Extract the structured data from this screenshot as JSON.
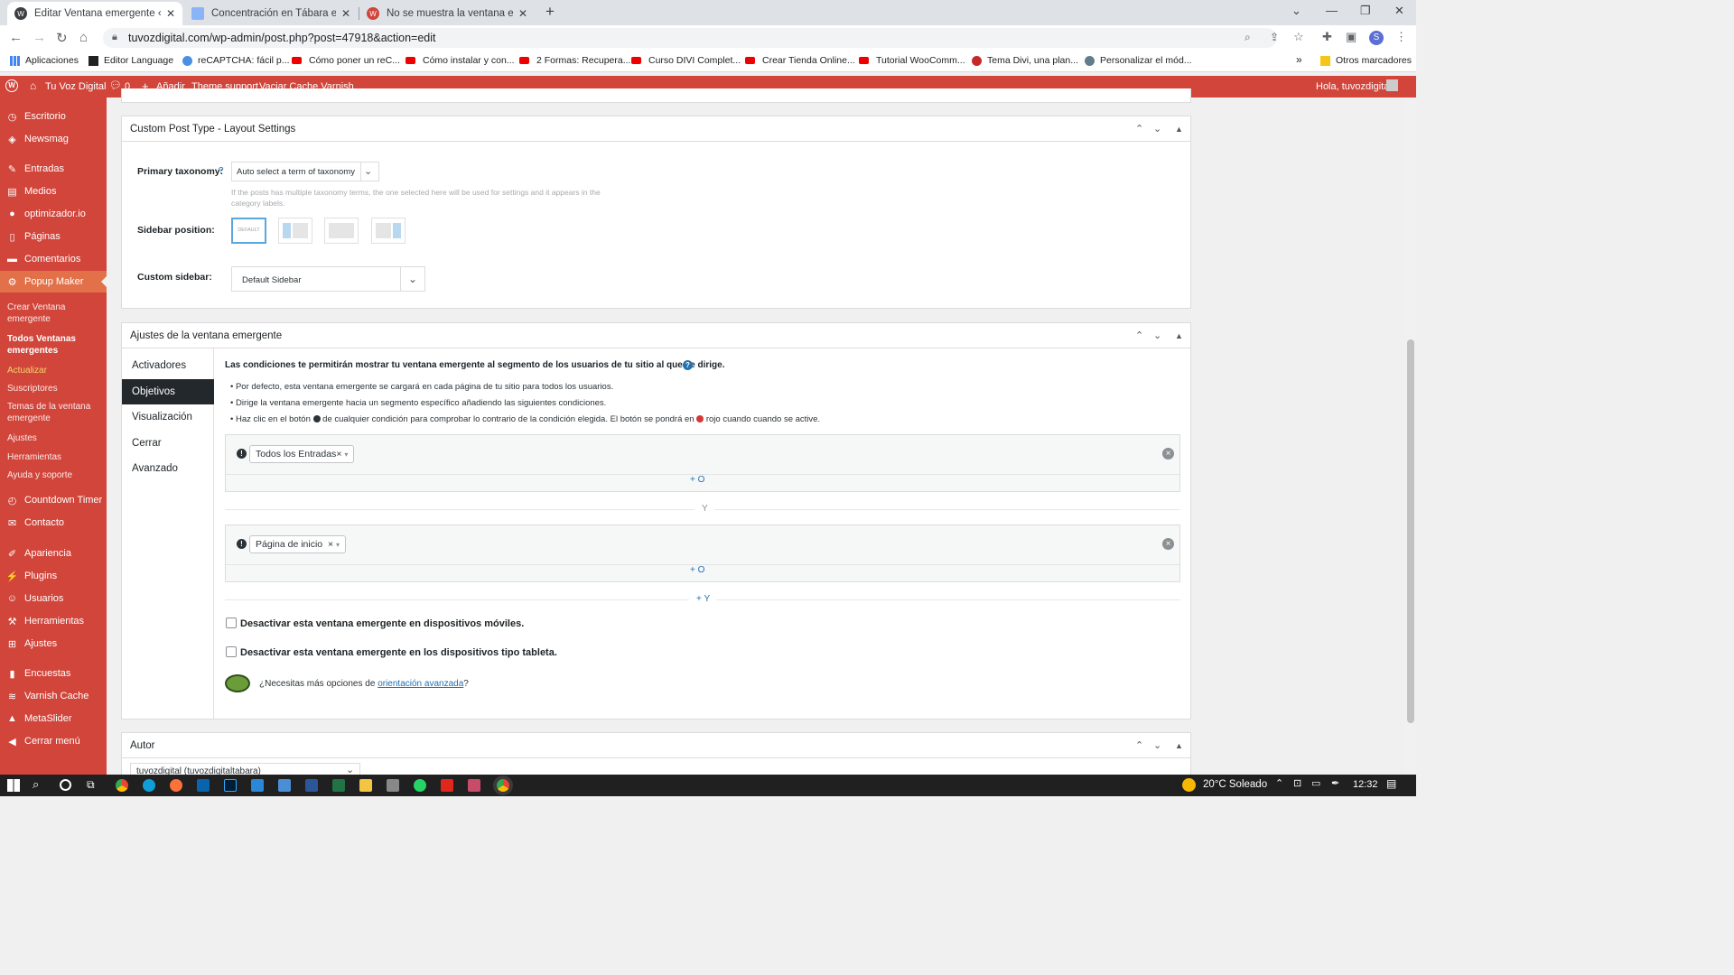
{
  "browser": {
    "tabs": [
      {
        "title": "Editar Ventana emergente «Prue",
        "active": true
      },
      {
        "title": "Concentración en Tábara en defe",
        "active": false
      },
      {
        "title": "No se muestra la ventana emerg",
        "active": false
      }
    ],
    "new_tab_label": "+",
    "url": "tuvozdigital.com/wp-admin/post.php?post=47918&action=edit",
    "profile_initial": "S",
    "bookmarks": [
      "Aplicaciones",
      "Editor Language",
      "reCAPTCHA: fácil p...",
      "Cómo poner un reC...",
      "Cómo instalar y con...",
      "2 Formas: Recupera...",
      "Curso DIVI Complet...",
      "Crear Tienda Online...",
      "Tutorial WooComm...",
      "Tema Divi, una plan...",
      "Personalizar el mód..."
    ],
    "bookmarks_more": "»",
    "other_bookmarks": "Otros marcadores"
  },
  "adminbar": {
    "site_name": "Tu Voz Digital",
    "comments_count": "0",
    "add_new": "Añadir",
    "theme_support": "Theme support",
    "vaciar_cache": "Vaciar Cache Varnish",
    "greeting": "Hola, tuvozdigital"
  },
  "sidebar": {
    "items": [
      {
        "label": "Escritorio"
      },
      {
        "label": "Newsmag"
      },
      {
        "label": "Entradas"
      },
      {
        "label": "Medios"
      },
      {
        "label": "optimizador.io"
      },
      {
        "label": "Páginas"
      },
      {
        "label": "Comentarios"
      },
      {
        "label": "Popup Maker"
      },
      {
        "label": "Countdown Timer"
      },
      {
        "label": "Contacto"
      },
      {
        "label": "Apariencia"
      },
      {
        "label": "Plugins"
      },
      {
        "label": "Usuarios"
      },
      {
        "label": "Herramientas"
      },
      {
        "label": "Ajustes"
      },
      {
        "label": "Encuestas"
      },
      {
        "label": "Varnish Cache"
      },
      {
        "label": "MetaSlider"
      },
      {
        "label": "Cerrar menú"
      }
    ],
    "submenu": [
      "Crear Ventana emergente",
      "Todos Ventanas emergentes",
      "Actualizar",
      "Suscriptores",
      "Temas de la ventana emergente",
      "Ajustes",
      "Herramientas",
      "Ayuda y soporte"
    ]
  },
  "layout_box": {
    "title": "Custom Post Type - Layout Settings",
    "primary_taxonomy_label": "Primary taxonomy:",
    "help_mark": "?",
    "primary_taxonomy_value": "Auto select a term of taxonomy",
    "primary_taxonomy_help": "If the posts has multiple taxonomy terms, the one selected here will be used for settings and it appears in the category labels.",
    "sidebar_position_label": "Sidebar position:",
    "sidebar_default_text": "DEFAULT",
    "custom_sidebar_label": "Custom sidebar:",
    "custom_sidebar_value": "Default Sidebar"
  },
  "popup_box": {
    "title": "Ajustes de la ventana emergente",
    "tabs": [
      "Activadores",
      "Objetivos",
      "Visualización",
      "Cerrar",
      "Avanzado"
    ],
    "intro": "Las condiciones te permitirán mostrar tu ventana emergente al segmento de los usuarios de tu sitio al que se dirige.",
    "bullets": [
      "Por defecto, esta ventana emergente se cargará en cada página de tu sitio para todos los usuarios.",
      "Dirige la ventana emergente hacia un segmento específico añadiendo las siguientes condiciones."
    ],
    "bullet3_a": "Haz clic en el botón",
    "bullet3_b": "de cualquier condición para comprobar lo contrario de la condición elegida. El botón se pondrá en",
    "bullet3_c": "rojo cuando cuando se active.",
    "condition1": "Todos los Entradas",
    "condition2": "Página de inicio",
    "chip_remove": "×",
    "add_or": "+ O",
    "and_label": "Y",
    "add_and": "+ Y",
    "disable_mobile": "Desactivar esta ventana emergente en dispositivos móviles.",
    "disable_tablet": "Desactivar esta ventana emergente en los dispositivos tipo tableta.",
    "advanced_prefix": "¿Necesitas más opciones de",
    "advanced_link": "orientación avanzada",
    "advanced_suffix": "?"
  },
  "author_box": {
    "title": "Autor",
    "value": "tuvozdigital (tuvozdigitaltabara)"
  },
  "taskbar": {
    "weather": "20°C  Soleado",
    "time": "12:32"
  },
  "colors": {
    "admin_red": "#d1453b",
    "active_menu": "#e2714a",
    "link_blue": "#2271b1"
  }
}
